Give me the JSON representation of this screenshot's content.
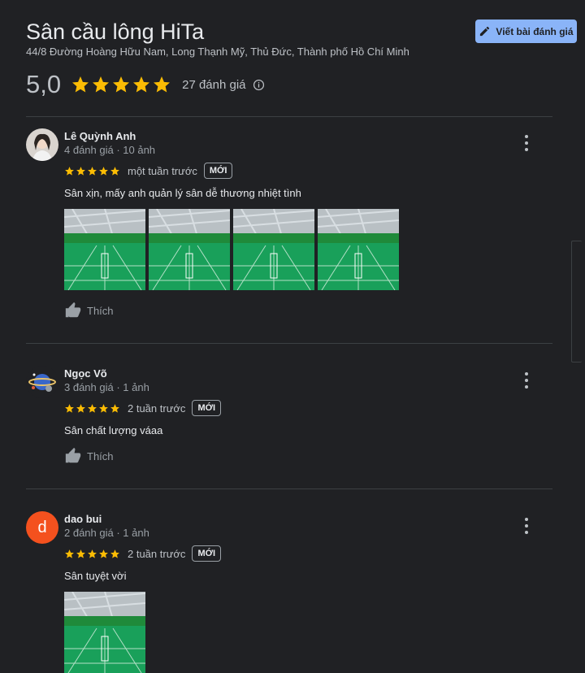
{
  "place": {
    "title": "Sân cầu lông HiTa",
    "address": "44/8 Đường Hoàng Hữu Nam, Long Thạnh Mỹ, Thủ Đức, Thành phố Hồ Chí Minh",
    "rating": "5,0",
    "rating_stars": 5,
    "review_count": "27 đánh giá",
    "write_review_label": "Viết bài đánh giá"
  },
  "colors": {
    "star": "#fbbc04",
    "accent": "#8ab4f8",
    "background": "#202124"
  },
  "reviews": [
    {
      "name": "Lê Quỳnh Anh",
      "meta": "4 đánh giá · 10 ảnh",
      "stars": 5,
      "time": "một tuần trước",
      "badge": "MỚI",
      "text": "Sân xịn, mấy anh quản lý sân dễ thương nhiệt tình",
      "photo_count": 4,
      "like_label": "Thích"
    },
    {
      "name": "Ngọc Võ",
      "meta": "3 đánh giá · 1 ảnh",
      "stars": 5,
      "time": "2 tuần trước",
      "badge": "MỚI",
      "text": "Sân chất lượng váaa",
      "like_label": "Thích"
    },
    {
      "name": "dao bui",
      "avatar_letter": "d",
      "meta": "2 đánh giá · 1 ảnh",
      "stars": 5,
      "time": "2 tuần trước",
      "badge": "MỚI",
      "text": "Sân tuyệt vời",
      "photo_count": 1
    }
  ]
}
